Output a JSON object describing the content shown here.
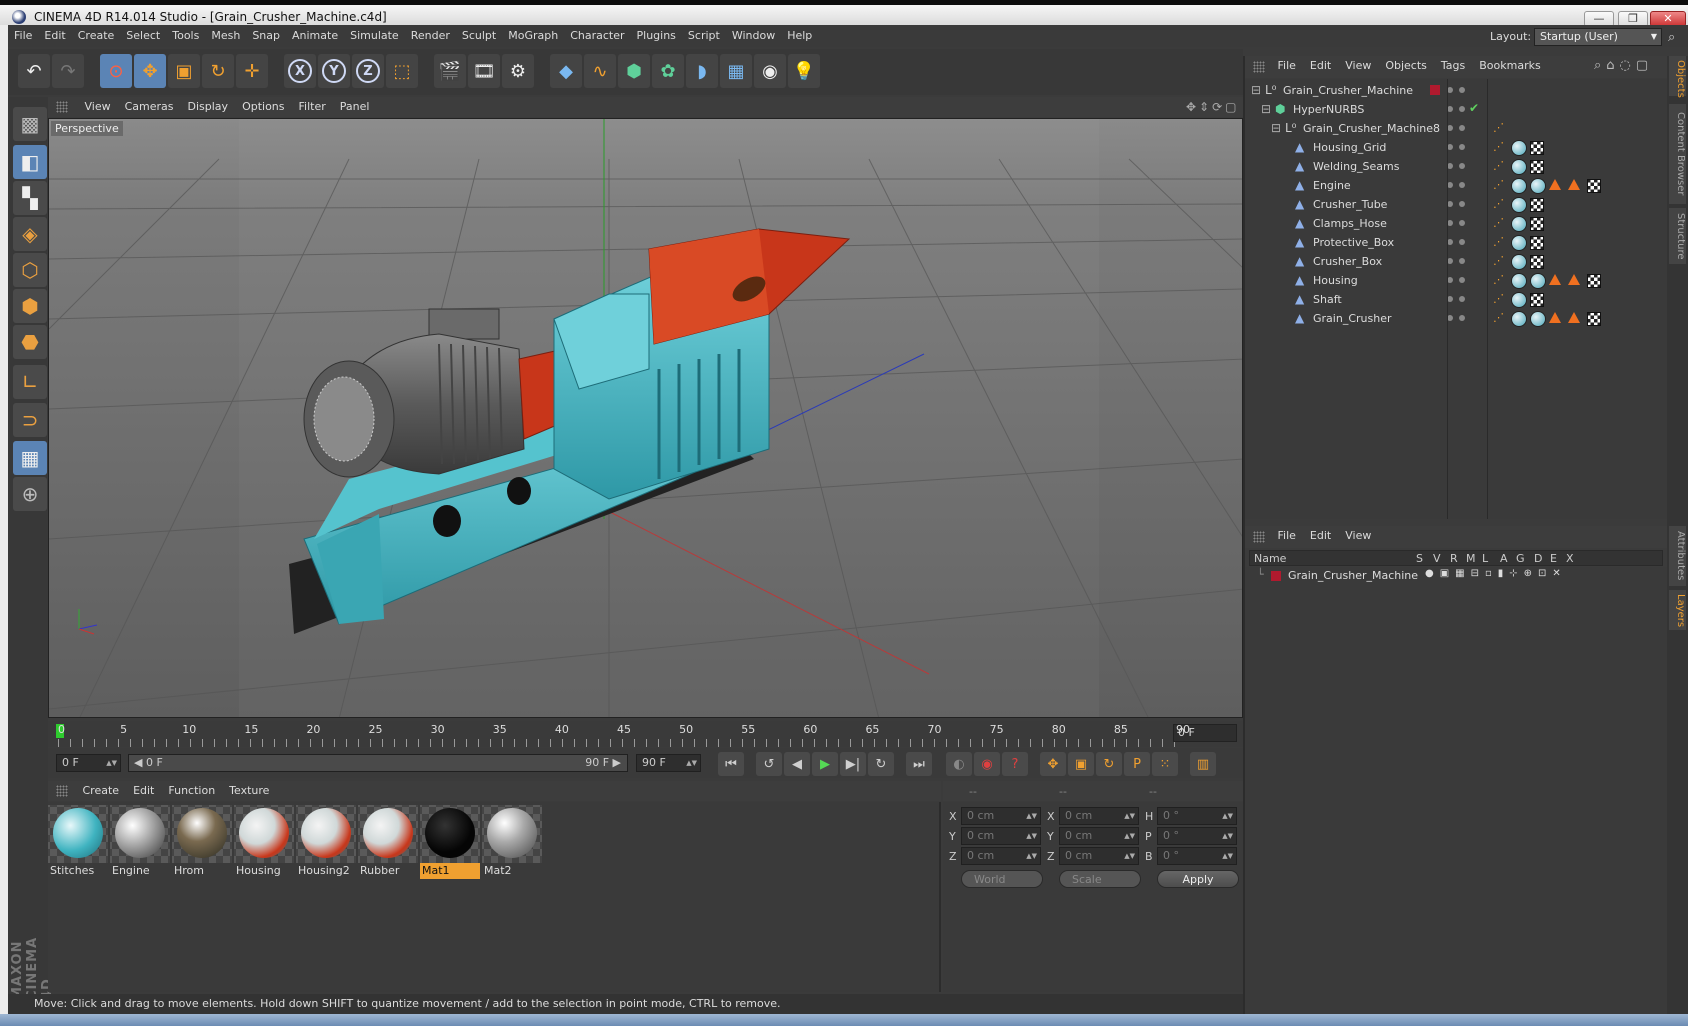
{
  "window": {
    "title": "CINEMA 4D R14.014 Studio - [Grain_Crusher_Machine.c4d]",
    "controls": [
      "—",
      "❐",
      "✕"
    ]
  },
  "menu": [
    "File",
    "Edit",
    "Create",
    "Select",
    "Tools",
    "Mesh",
    "Snap",
    "Animate",
    "Simulate",
    "Render",
    "Sculpt",
    "MoGraph",
    "Character",
    "Plugins",
    "Script",
    "Window",
    "Help"
  ],
  "layout": {
    "label": "Layout:",
    "value": "Startup (User)"
  },
  "viewport": {
    "menu": [
      "View",
      "Cameras",
      "Display",
      "Options",
      "Filter",
      "Panel"
    ],
    "label": "Perspective",
    "nav_icons": [
      "move-view-icon",
      "pan-view-icon",
      "rotate-view-icon",
      "maximize-view-icon"
    ]
  },
  "timeline": {
    "ticks": [
      "0",
      "5",
      "10",
      "15",
      "20",
      "25",
      "30",
      "35",
      "40",
      "45",
      "50",
      "55",
      "60",
      "65",
      "70",
      "75",
      "80",
      "85",
      "90"
    ],
    "current_frame": "0 F",
    "end_frame_field": "0 F"
  },
  "transport": {
    "start": "0 F",
    "range_left": "◀ 0 F",
    "range_right": "90 F ▶",
    "end": "90 F"
  },
  "materials": {
    "menu": [
      "Create",
      "Edit",
      "Function",
      "Texture"
    ],
    "items": [
      {
        "name": "Stitches"
      },
      {
        "name": "Engine"
      },
      {
        "name": "Hrom"
      },
      {
        "name": "Housing"
      },
      {
        "name": "Housing2"
      },
      {
        "name": "Rubber"
      },
      {
        "name": "Mat1"
      },
      {
        "name": "Mat2"
      }
    ],
    "active": "Mat1"
  },
  "coordinates": {
    "headers": [
      "--",
      "--",
      "--"
    ],
    "rows": [
      {
        "a": "X",
        "a_val": "0 cm",
        "b": "X",
        "b_val": "0 cm",
        "c": "H",
        "c_val": "0 °"
      },
      {
        "a": "Y",
        "a_val": "0 cm",
        "b": "Y",
        "b_val": "0 cm",
        "c": "P",
        "c_val": "0 °"
      },
      {
        "a": "Z",
        "a_val": "0 cm",
        "b": "Z",
        "b_val": "0 cm",
        "c": "B",
        "c_val": "0 °"
      }
    ],
    "world": "World",
    "scale": "Scale",
    "apply": "Apply"
  },
  "status": "Move: Click and drag to move elements. Hold down SHIFT to quantize movement / add to the selection in point mode, CTRL to remove.",
  "objects": {
    "menu": [
      "File",
      "Edit",
      "View",
      "Objects",
      "Tags",
      "Bookmarks"
    ],
    "tree": [
      {
        "name": "Grain_Crusher_Machine",
        "level": 0,
        "kind": "null"
      },
      {
        "name": "HyperNURBS",
        "level": 1,
        "kind": "nurbs"
      },
      {
        "name": "Grain_Crusher_Machine8",
        "level": 2,
        "kind": "null"
      },
      {
        "name": "Housing_Grid",
        "level": 3,
        "kind": "poly",
        "tags": [
          "phong",
          "mat",
          "chk"
        ]
      },
      {
        "name": "Welding_Seams",
        "level": 3,
        "kind": "poly",
        "tags": [
          "phong",
          "mat",
          "chk"
        ]
      },
      {
        "name": "Engine",
        "level": 3,
        "kind": "poly",
        "tags": [
          "phong",
          "mat",
          "mat",
          "tri",
          "tri",
          "chk"
        ]
      },
      {
        "name": "Crusher_Tube",
        "level": 3,
        "kind": "poly",
        "tags": [
          "phong",
          "mat",
          "chk"
        ]
      },
      {
        "name": "Clamps_Hose",
        "level": 3,
        "kind": "poly",
        "tags": [
          "phong",
          "mat",
          "chk"
        ]
      },
      {
        "name": "Protective_Box",
        "level": 3,
        "kind": "poly",
        "tags": [
          "phong",
          "mat",
          "chk"
        ]
      },
      {
        "name": "Crusher_Box",
        "level": 3,
        "kind": "poly",
        "tags": [
          "phong",
          "mat",
          "chk"
        ]
      },
      {
        "name": "Housing",
        "level": 3,
        "kind": "poly",
        "tags": [
          "phong",
          "mat",
          "mat",
          "tri",
          "tri",
          "chk"
        ]
      },
      {
        "name": "Shaft",
        "level": 3,
        "kind": "poly",
        "tags": [
          "phong",
          "mat",
          "chk"
        ]
      },
      {
        "name": "Grain_Crusher",
        "level": 3,
        "kind": "poly",
        "tags": [
          "phong",
          "mat",
          "mat",
          "tri",
          "tri",
          "chk"
        ]
      }
    ]
  },
  "layers": {
    "menu": [
      "File",
      "Edit",
      "View"
    ],
    "columns": [
      "Name",
      "S",
      "V",
      "R",
      "M",
      "L",
      "A",
      "G",
      "D",
      "E",
      "X"
    ],
    "rows": [
      {
        "name": "Grain_Crusher_Machine",
        "color": "#b01a2e"
      }
    ]
  },
  "right_tabs": [
    "Objects",
    "Content Browser",
    "Structure",
    "Attributes",
    "Layers"
  ],
  "branding": "MAXON CINEMA 4D",
  "colors": {
    "accent": "#f0a030",
    "selection": "#5b84b5",
    "model_body": "#3fb3c0",
    "model_red": "#c8361a"
  }
}
